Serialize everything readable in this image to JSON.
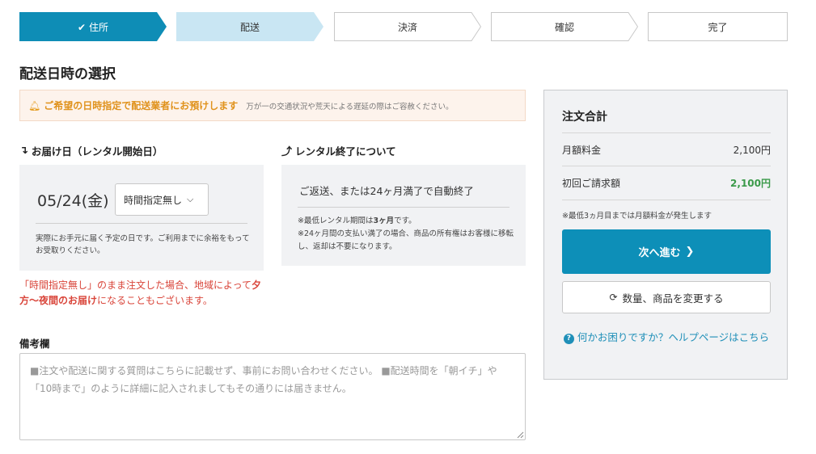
{
  "stepper": {
    "steps": [
      {
        "label": "住所",
        "state": "done",
        "icon": "check-icon"
      },
      {
        "label": "配送",
        "state": "current"
      },
      {
        "label": "決済",
        "state": "pending"
      },
      {
        "label": "確認",
        "state": "pending"
      },
      {
        "label": "完了",
        "state": "pending"
      }
    ],
    "colors": {
      "done": "#0e8db6",
      "current": "#c9e6f3",
      "pending_border": "#c8c8c8"
    }
  },
  "page": {
    "title": "配送日時の選択"
  },
  "notice": {
    "icon": "bell-icon",
    "main": "ご希望の日時指定で配送業者にお預けします",
    "sub": "万が一の交通状況や荒天による遅延の際はご容赦ください。"
  },
  "delivery": {
    "heading": "お届け日（レンタル開始日）",
    "heading_icon": "arrow-down-right-icon",
    "date": "05/24(金)",
    "time_select": "時間指定無し",
    "note": "実際にお手元に届く予定の日です。ご利用までに余裕をもってお受取りください。",
    "warn_1": "「時間指定無し」のまま注文した場合、地域によって",
    "warn_bold": "夕方〜夜間のお届け",
    "warn_2": "になることもございます。"
  },
  "rental_end": {
    "heading": "レンタル終了について",
    "heading_icon": "arrow-up-right-icon",
    "main": "ご返送、または24ヶ月満了で自動終了",
    "note_1a": "※最低レンタル期間は",
    "note_1b": "3ヶ月",
    "note_1c": "です。",
    "note_2": "※24ヶ月間の支払い満了の場合、商品の所有権はお客様に移転し、返却は不要になります。"
  },
  "remarks": {
    "label": "備考欄",
    "placeholder": "■注文や配送に関する質問はこちらに記載せず、事前にお問い合わせください。 ■配送時間を「朝イチ」や「10時まで」のように詳細に記入されましてもその通りには届きません。"
  },
  "summary": {
    "title": "注文合計",
    "monthly_label": "月額料金",
    "monthly_value": "2,100円",
    "first_label": "初回ご請求額",
    "first_value": "2,100円",
    "note": "※最低3ヵ月目までは月額料金が発生します",
    "next_label": "次へ進む",
    "change_label": "数量、商品を変更する",
    "help_label": "何かお困りですか？ヘルプページはこちら"
  },
  "colors": {
    "accent": "#0d8fb8",
    "warn": "#d9453a",
    "notice": "#e0921c",
    "green": "#3b9a4a"
  }
}
